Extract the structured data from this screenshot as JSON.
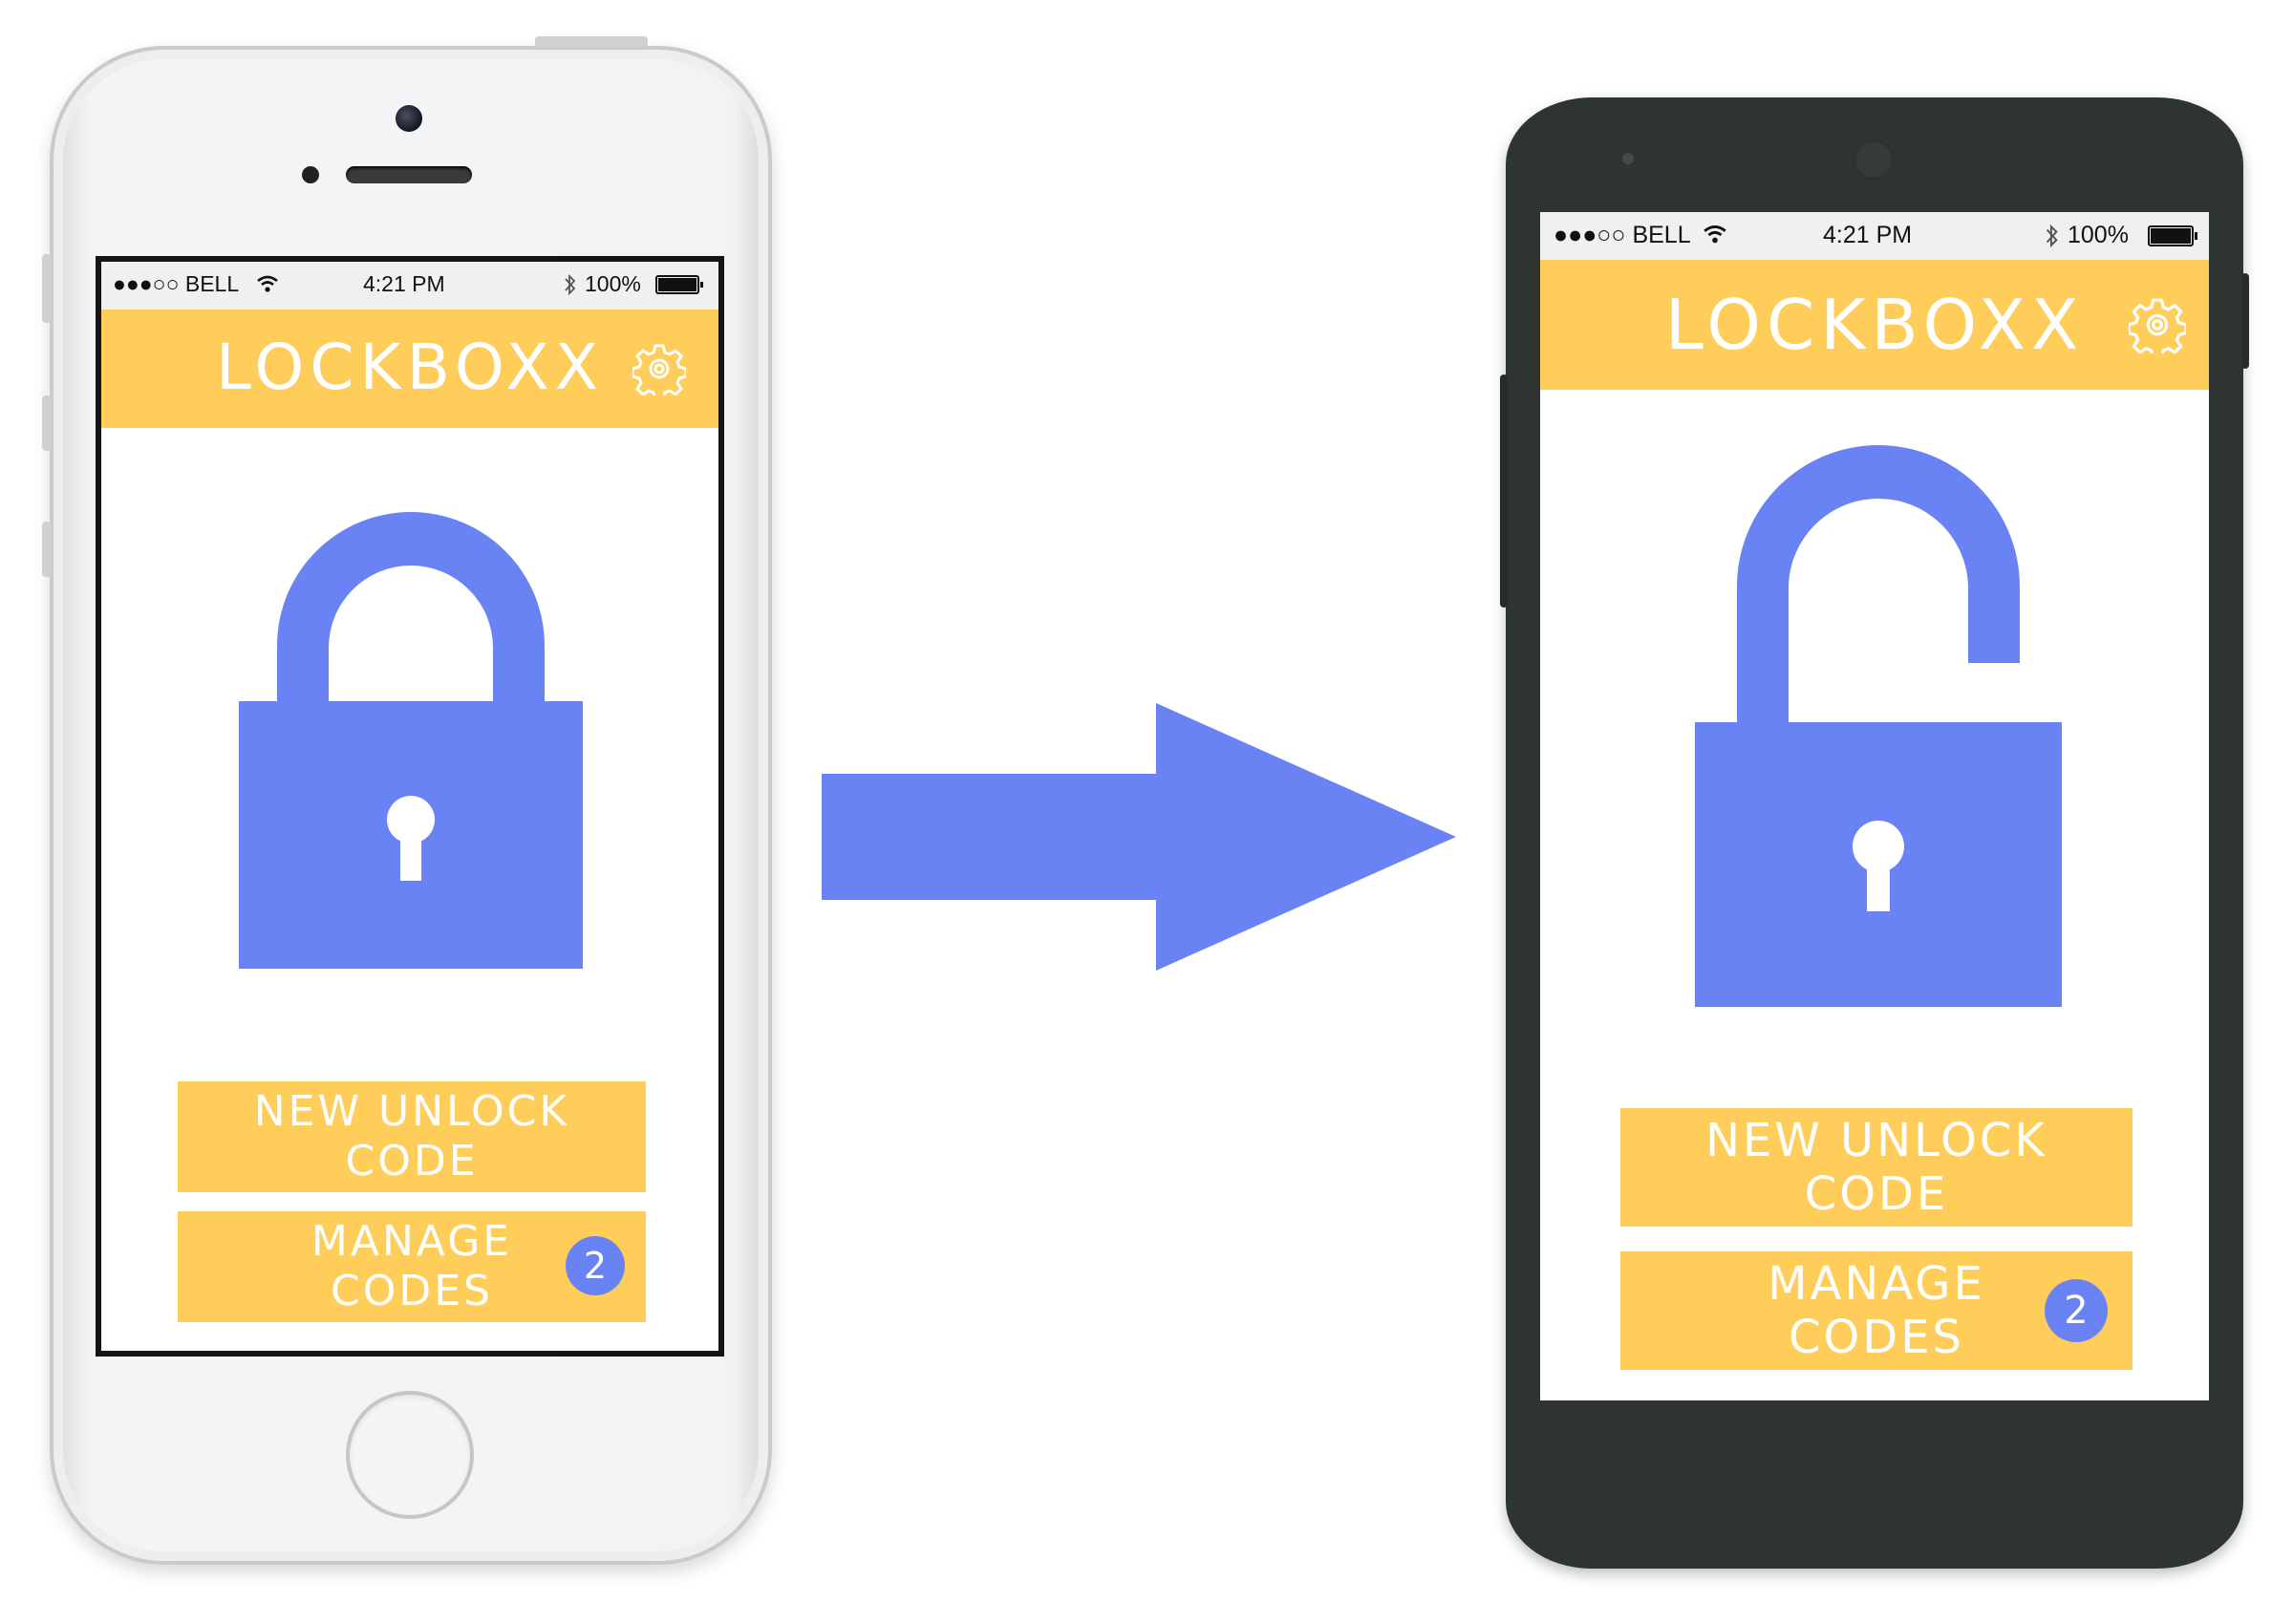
{
  "colors": {
    "accent": "#fecd5a",
    "lock": "#6a83f4",
    "iphone_body": "#f2f3f5",
    "android_body": "#2d3431"
  },
  "locked_phone": {
    "status_bar": {
      "carrier": "●●●○○ BELL",
      "time": "4:21 PM",
      "battery": "100%"
    },
    "app_title": "LOCKBOXX",
    "settings_icon": "gear-icon",
    "lock_icon": "closed-padlock-icon",
    "buttons": {
      "new_unlock_code": [
        "NEW UNLOCK",
        "CODE"
      ],
      "manage_codes": [
        "MANAGE",
        "CODES"
      ]
    },
    "manage_codes_badge": "2"
  },
  "transition_icon": "right-arrow-icon",
  "unlocked_phone": {
    "status_bar": {
      "carrier": "●●●○○ BELL",
      "time": "4:21 PM",
      "battery": "100%"
    },
    "app_title": "LOCKBOXX",
    "settings_icon": "gear-icon",
    "lock_icon": "open-padlock-icon",
    "buttons": {
      "new_unlock_code": [
        "NEW UNLOCK",
        "CODE"
      ],
      "manage_codes": [
        "MANAGE",
        "CODES"
      ]
    },
    "manage_codes_badge": "2"
  }
}
